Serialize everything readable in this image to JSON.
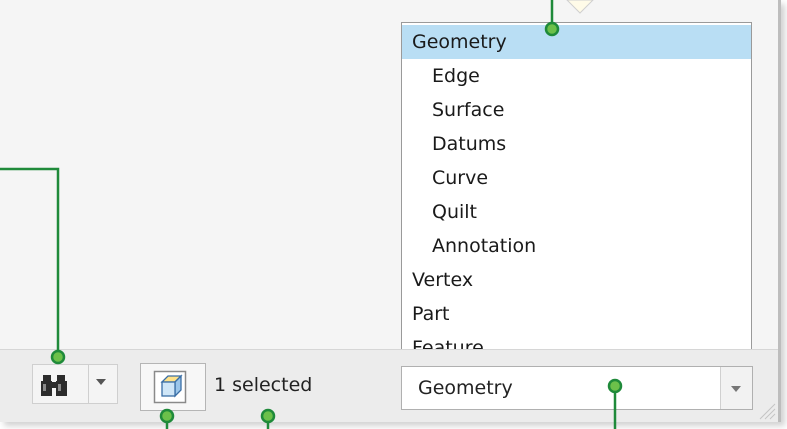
{
  "filter_dropdown": {
    "items": [
      {
        "label": "Geometry",
        "level": 0,
        "selected": true
      },
      {
        "label": "Edge",
        "level": 1
      },
      {
        "label": "Surface",
        "level": 1
      },
      {
        "label": "Datums",
        "level": 1
      },
      {
        "label": "Curve",
        "level": 1
      },
      {
        "label": "Quilt",
        "level": 1
      },
      {
        "label": "Annotation",
        "level": 1
      },
      {
        "label": "Vertex",
        "level": 0
      },
      {
        "label": "Part",
        "level": 0
      },
      {
        "label": "Feature",
        "level": 0
      }
    ]
  },
  "status_bar": {
    "find_icon": "binoculars-icon",
    "selection_icon": "selection-cube-icon",
    "selection_count_text": "1 selected",
    "filter_value": "Geometry"
  },
  "colors": {
    "highlight": "#b9def4",
    "callout_line": "#1f8a3a",
    "callout_dot": "#6cc04a"
  }
}
